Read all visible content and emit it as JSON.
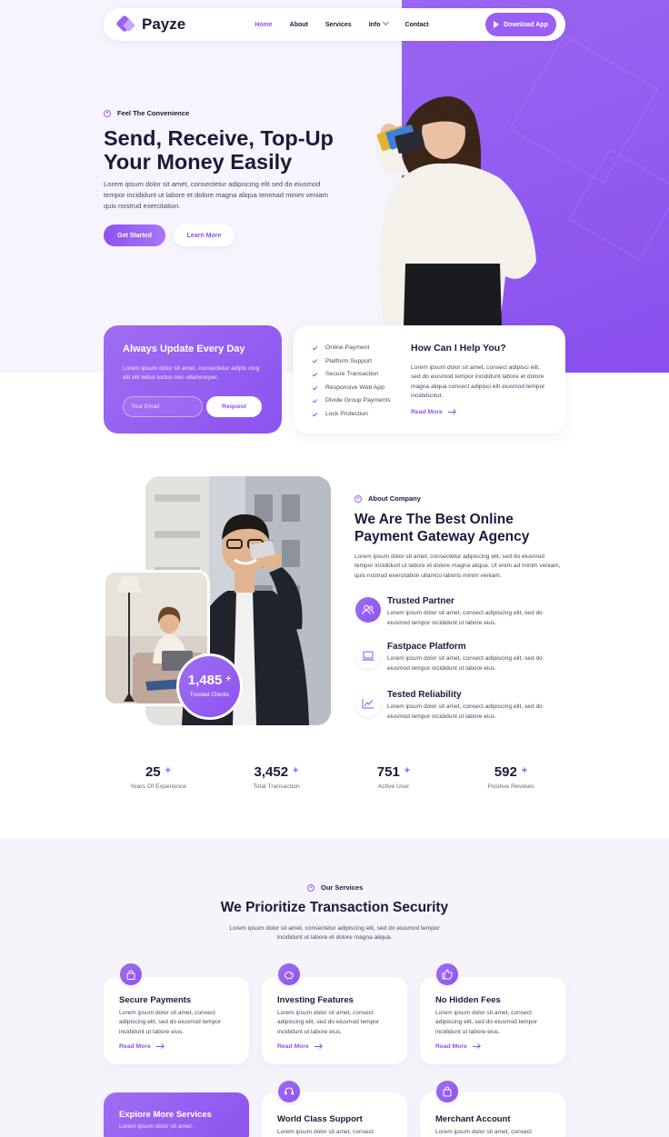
{
  "brand": {
    "name": "Payze",
    "accent": "#8c53ef"
  },
  "nav": {
    "items": [
      "Home",
      "About",
      "Services",
      "Info",
      "Contact"
    ],
    "active": "Home",
    "download": "Download App"
  },
  "hero": {
    "eyebrow": "Feel The Convenience",
    "title": "Send, Receive, Top-Up Your Money Easily",
    "text": "Lorem ipsum dolor sit amet, consectetur adipiscing elit sed do eiusmod tempor incididunt ut labore et dolore magna aliqua tenimad minim veniam quis nostrud exercitation.",
    "get_started": "Get Started",
    "learn_more": "Learn More"
  },
  "update_card": {
    "title": "Always Update Every Day",
    "text": "Lorem ipsum dolor sit amet, consectetur adipis cing elit elit tellus luctus nec ullamcorper.",
    "email_placeholder": "Your Email",
    "request": "Request"
  },
  "help_card": {
    "checklist": [
      "Online Payment",
      "Platform Support",
      "Secure Transaction",
      "Responsive Web App",
      "Divide Group Payments",
      "Lock Protection"
    ],
    "title": "How Can I Help You?",
    "text": "Lorem ipsum dolor sit amet, consect adipisci elit, sed do eiusmod tempor incididunt labore et dolore magna aliqua consect adipisci elit eiusmod tempor incididuntut.",
    "read_more": "Read More"
  },
  "about": {
    "clients_count": "1,485",
    "clients_plus": "+",
    "clients_label": "Trusted Clients",
    "eyebrow": "About Company",
    "title": "We Are The Best Online Payment Gateway Agency",
    "text": "Lorem ipsum dolor sit amet, consectetur adipiscing elit, sed do eiusmod tempor incididunt ut labore et dolore magna aliqua. Ut enim ad minim veniam, quis nostrud exercitation ullamco laboris minim veniam.",
    "features": [
      {
        "title": "Trusted Partner",
        "text": "Lorem ipsum dolor sit amet, consect adipiscing elit, sed do eiusmod tempor incididunt ut labore eius.",
        "icon": "users-icon"
      },
      {
        "title": "Fastpace Platform",
        "text": "Lorem ipsum dolor sit amet, consect adipiscing elit, sed do eiusmod tempor incididunt ut labore eius.",
        "icon": "laptop-icon"
      },
      {
        "title": "Tested Reliability",
        "text": "Lorem ipsum dolor sit amet, consect adipiscing elit, sed do eiusmod tempor incididunt ut labore eius.",
        "icon": "chart-icon"
      }
    ]
  },
  "stats": [
    {
      "value": "25",
      "plus": "+",
      "label": "Years Of Experience"
    },
    {
      "value": "3,452",
      "plus": "+",
      "label": "Total Transaction"
    },
    {
      "value": "751",
      "plus": "+",
      "label": "Active User"
    },
    {
      "value": "592",
      "plus": "+",
      "label": "Positive Reviews"
    }
  ],
  "services": {
    "eyebrow": "Our Services",
    "title": "We Prioritize Transaction Security",
    "text": "Lorem ipsum dolor sit amet, consectetur adipiscing elit, sed do eiusmod tempor incididunt ut labore et dolore magna aliqua.",
    "cards": [
      {
        "title": "Secure Payments",
        "text": "Lorem ipsum dolor sit amet, consect adipiscing elit, sed do eiusmod tempor incididunt ut labore eius.",
        "more": "Read More",
        "icon": "lock-icon"
      },
      {
        "title": "Investing Features",
        "text": "Lorem ipsum dolor sit amet, consect adipiscing elit, sed do eiusmod tempor incididunt ut labore eius.",
        "more": "Read More",
        "icon": "piggy-bank-icon"
      },
      {
        "title": "No Hidden Fees",
        "text": "Lorem ipsum dolor sit amet, consect adipiscing elit, sed do eiusmod tempor incididunt ut labore eius.",
        "more": "Read More",
        "icon": "thumbs-up-icon"
      }
    ],
    "explore_title": "Explore More Services",
    "explore_text": "Lorem ipsum dolor sit amet.",
    "cards2": [
      {
        "title": "World Class Support",
        "text": "Lorem ipsum dolor sit amet, consect",
        "icon": "support-icon"
      },
      {
        "title": "Merchant Account",
        "text": "Lorem ipsum dolor sit amet, consect",
        "icon": "bag-icon"
      }
    ]
  }
}
